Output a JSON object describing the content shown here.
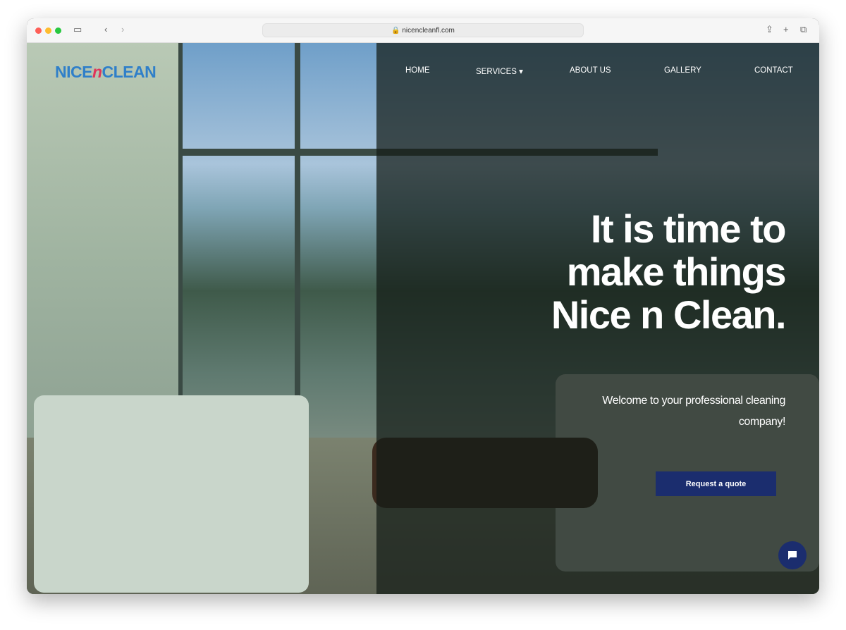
{
  "browser": {
    "url": "nicencleanfl.com"
  },
  "logo": {
    "part1": "NICE",
    "part2": "n",
    "part3": "CLEAN"
  },
  "nav": [
    "HOME",
    "SERVICES",
    "ABOUT US",
    "GALLERY",
    "CONTACT"
  ],
  "hero": {
    "headline": "It is time to make things Nice n Clean.",
    "subtitle": "Welcome to your professional cleaning company!",
    "cta": "Request a quote"
  },
  "colors": {
    "brand": "#1b2d6e",
    "logo": "#2f7fc9"
  },
  "icons": {
    "chat": "chat-bubble-icon"
  }
}
